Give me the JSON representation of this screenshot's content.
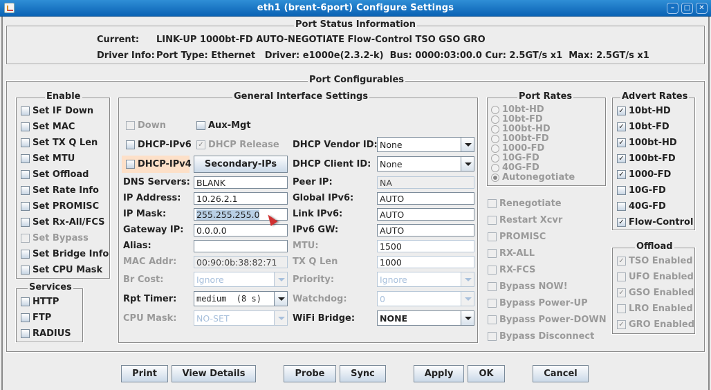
{
  "window": {
    "title": "eth1 (brent-6port) Configure Settings",
    "controls": [
      "minimize",
      "maximize",
      "close"
    ]
  },
  "status": {
    "title": "Port Status Information",
    "current_label": "Current:",
    "current_value": "LINK-UP 1000bt-FD AUTO-NEGOTIATE Flow-Control TSO GSO GRO",
    "driver_label": "Driver Info:",
    "driver_value": "Port Type: Ethernet   Driver: e1000e(2.3.2-k)  Bus: 0000:03:00.0 Cur: 2.5GT/s x1  Max: 2.5GT/s x1"
  },
  "configurables_title": "Port Configurables",
  "enable": {
    "title": "Enable",
    "items": [
      {
        "label": "Set IF Down",
        "checked": false,
        "disabled": false
      },
      {
        "label": "Set MAC",
        "checked": false,
        "disabled": false
      },
      {
        "label": "Set TX Q Len",
        "checked": false,
        "disabled": false
      },
      {
        "label": "Set MTU",
        "checked": false,
        "disabled": false
      },
      {
        "label": "Set Offload",
        "checked": false,
        "disabled": false
      },
      {
        "label": "Set Rate Info",
        "checked": false,
        "disabled": false
      },
      {
        "label": "Set PROMISC",
        "checked": false,
        "disabled": false
      },
      {
        "label": "Set Rx-All/FCS",
        "checked": false,
        "disabled": false
      },
      {
        "label": "Set Bypass",
        "checked": false,
        "disabled": true
      },
      {
        "label": "Set Bridge Info",
        "checked": false,
        "disabled": false
      },
      {
        "label": "Set CPU Mask",
        "checked": false,
        "disabled": false
      }
    ]
  },
  "services": {
    "title": "Services",
    "items": [
      {
        "label": "HTTP",
        "checked": false
      },
      {
        "label": "FTP",
        "checked": false
      },
      {
        "label": "RADIUS",
        "checked": false
      }
    ]
  },
  "general": {
    "title": "General Interface Settings",
    "down": {
      "label": "Down",
      "checked": false
    },
    "aux_mgt": {
      "label": "Aux-Mgt",
      "checked": false
    },
    "dhcp_ipv6": {
      "label": "DHCP-IPv6",
      "checked": false
    },
    "dhcp_release": {
      "label": "DHCP Release",
      "checked": true
    },
    "dhcp_ipv4": {
      "label": "DHCP-IPv4",
      "checked": false
    },
    "secondary_ips": "Secondary-IPs",
    "dns_servers": {
      "label": "DNS Servers:",
      "value": "BLANK"
    },
    "ip_address": {
      "label": "IP Address:",
      "value": "10.26.2.1"
    },
    "ip_mask": {
      "label": "IP Mask:",
      "value": "255.255.255.0"
    },
    "gateway_ip": {
      "label": "Gateway IP:",
      "value": "0.0.0.0"
    },
    "alias": {
      "label": "Alias:",
      "value": ""
    },
    "mac_addr": {
      "label": "MAC Addr:",
      "value": "00:90:0b:38:82:71"
    },
    "br_cost": {
      "label": "Br Cost:",
      "value": "Ignore"
    },
    "rpt_timer": {
      "label": "Rpt Timer:",
      "value": "medium  (8 s)"
    },
    "cpu_mask": {
      "label": "CPU Mask:",
      "value": "NO-SET"
    },
    "dhcp_vendor_id": {
      "label": "DHCP Vendor ID:",
      "value": "None"
    },
    "dhcp_client_id": {
      "label": "DHCP Client ID:",
      "value": "None"
    },
    "peer_ip": {
      "label": "Peer IP:",
      "value": "NA"
    },
    "global_ipv6": {
      "label": "Global IPv6:",
      "value": "AUTO"
    },
    "link_ipv6": {
      "label": "Link IPv6:",
      "value": "AUTO"
    },
    "ipv6_gw": {
      "label": "IPv6 GW:",
      "value": "AUTO"
    },
    "mtu": {
      "label": "MTU:",
      "value": "1500"
    },
    "tx_q_len": {
      "label": "TX Q Len",
      "value": "1000"
    },
    "priority": {
      "label": "Priority:",
      "value": "Ignore"
    },
    "watchdog": {
      "label": "Watchdog:",
      "value": "0"
    },
    "wifi_bridge": {
      "label": "WiFi Bridge:",
      "value": "NONE"
    }
  },
  "port_rates": {
    "title": "Port Rates",
    "options": [
      "10bt-HD",
      "10bt-FD",
      "100bt-HD",
      "100bt-FD",
      "1000-FD",
      "10G-FD",
      "40G-FD",
      "Autonegotiate"
    ],
    "selected": "Autonegotiate"
  },
  "misc_options": [
    {
      "label": "Renegotiate",
      "checked": false
    },
    {
      "label": "Restart Xcvr",
      "checked": false
    },
    {
      "label": "PROMISC",
      "checked": false
    },
    {
      "label": "RX-ALL",
      "checked": false
    },
    {
      "label": "RX-FCS",
      "checked": false
    },
    {
      "label": "Bypass NOW!",
      "checked": false
    },
    {
      "label": "Bypass Power-UP",
      "checked": false
    },
    {
      "label": "Bypass Power-DOWN",
      "checked": false
    },
    {
      "label": "Bypass Disconnect",
      "checked": false
    }
  ],
  "advert_rates": {
    "title": "Advert Rates",
    "items": [
      {
        "label": "10bt-HD",
        "checked": true
      },
      {
        "label": "10bt-FD",
        "checked": true
      },
      {
        "label": "100bt-HD",
        "checked": true
      },
      {
        "label": "100bt-FD",
        "checked": true
      },
      {
        "label": "1000-FD",
        "checked": true
      },
      {
        "label": "10G-FD",
        "checked": false
      },
      {
        "label": "40G-FD",
        "checked": false
      },
      {
        "label": "Flow-Control",
        "checked": true
      }
    ]
  },
  "offload": {
    "title": "Offload",
    "items": [
      {
        "label": "TSO Enabled",
        "checked": true
      },
      {
        "label": "UFO Enabled",
        "checked": false
      },
      {
        "label": "GSO Enabled",
        "checked": true
      },
      {
        "label": "LRO Enabled",
        "checked": false
      },
      {
        "label": "GRO Enabled",
        "checked": true
      }
    ]
  },
  "buttons": {
    "print": "Print",
    "view_details": "View Details",
    "probe": "Probe",
    "sync": "Sync",
    "apply": "Apply",
    "ok": "OK",
    "cancel": "Cancel"
  }
}
